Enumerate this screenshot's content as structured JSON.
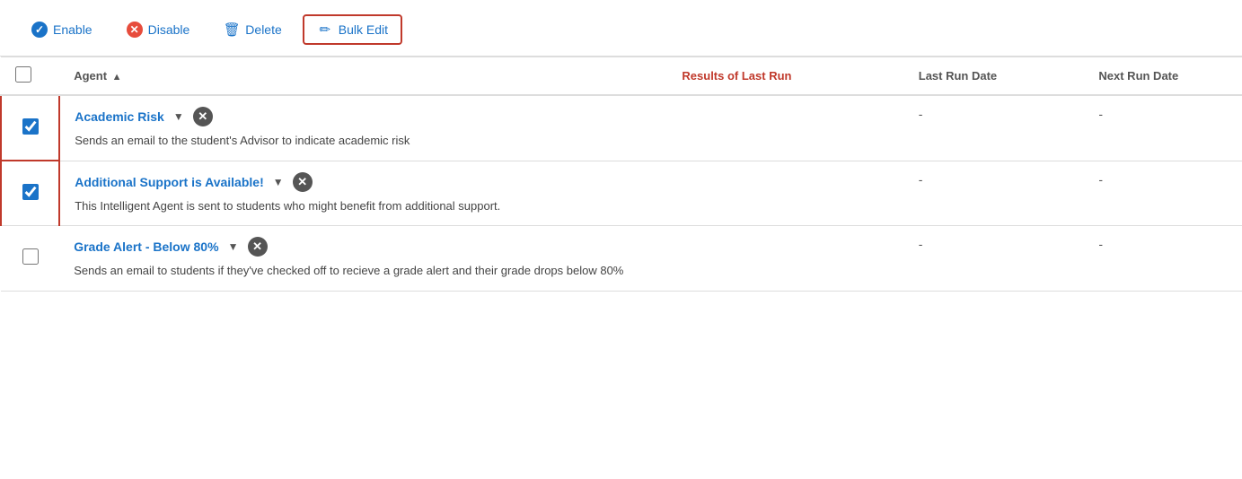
{
  "toolbar": {
    "enable_label": "Enable",
    "disable_label": "Disable",
    "delete_label": "Delete",
    "bulk_edit_label": "Bulk Edit"
  },
  "table": {
    "headers": {
      "checkbox": "",
      "agent": "Agent",
      "results": "Results of Last Run",
      "last_run": "Last Run Date",
      "next_run": "Next Run Date"
    },
    "rows": [
      {
        "id": "academic-risk",
        "name": "Academic Risk",
        "description": "Sends an email to the student's Advisor to indicate academic risk",
        "checked": true,
        "last_run_date": "-",
        "next_run_date": "-",
        "results": ""
      },
      {
        "id": "additional-support",
        "name": "Additional Support is Available!",
        "description": "This Intelligent Agent is sent to students who might benefit from additional support.",
        "checked": true,
        "last_run_date": "-",
        "next_run_date": "-",
        "results": ""
      },
      {
        "id": "grade-alert",
        "name": "Grade Alert - Below 80%",
        "description": "Sends an email to students if they've checked off to recieve a grade alert and their grade drops below 80%",
        "checked": false,
        "last_run_date": "-",
        "next_run_date": "-",
        "results": ""
      }
    ]
  }
}
